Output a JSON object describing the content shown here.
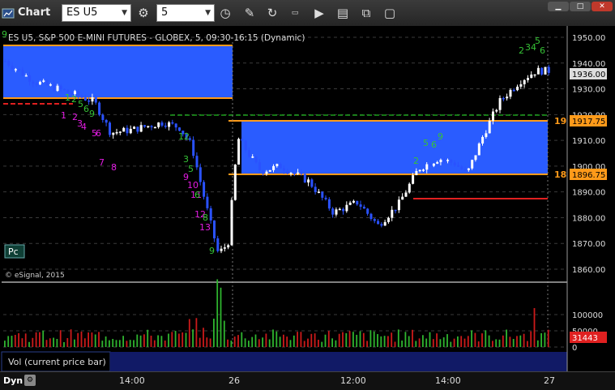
{
  "window": {
    "title": "Chart"
  },
  "toolbar": {
    "symbol": "ES U5",
    "interval": "5"
  },
  "chart": {
    "header": "ES U5, S&P 500 E-MINI FUTURES - GLOBEX, 5, 09:30-16:15 (Dynamic)",
    "watermark": "© eSignal, 2015",
    "pc_label": "Pc",
    "price_ticks": [
      "1950.00",
      "1940.00",
      "1930.00",
      "1920.00",
      "1910.00",
      "1900.00",
      "1890.00",
      "1880.00",
      "1870.00",
      "1860.00"
    ],
    "last_price": "1936.00",
    "zone_high_price": "1917.75",
    "zone_low_price": "1896.75",
    "zone_high_stub": "19",
    "zone_low_stub": "18"
  },
  "volume": {
    "label": "Vol (current price bar)",
    "ticks": [
      "100000",
      "50000",
      "0"
    ],
    "last": "31443"
  },
  "timeaxis": {
    "dyn_label": "Dyn",
    "labels": [
      "14:00",
      "26",
      "12:00",
      "14:00",
      "27"
    ]
  },
  "colors": {
    "zone_blue": "#2a5cff",
    "zone_orange": "#ff9a1a",
    "up_candle": "#ffffff",
    "down_candle": "#2a52ff",
    "counter_green": "#36c236",
    "counter_magenta": "#e31ce3",
    "support_red": "#e02020"
  }
}
